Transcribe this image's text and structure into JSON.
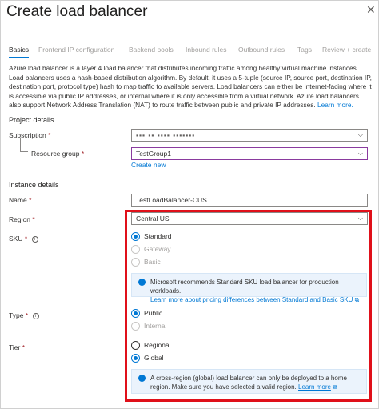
{
  "window": {
    "title": "Create load balancer"
  },
  "tabs": [
    {
      "label": "Basics"
    },
    {
      "label": "Frontend IP configuration"
    },
    {
      "label": "Backend pools"
    },
    {
      "label": "Inbound rules"
    },
    {
      "label": "Outbound rules"
    },
    {
      "label": "Tags"
    },
    {
      "label": "Review + create"
    }
  ],
  "intro": {
    "text": "Azure load balancer is a layer 4 load balancer that distributes incoming traffic among healthy virtual machine instances. Load balancers uses a hash-based distribution algorithm. By default, it uses a 5-tuple (source IP, source port, destination IP, destination port, protocol type) hash to map traffic to available servers. Load balancers can either be internet-facing where it is accessible via public IP addresses, or internal where it is only accessible from a virtual network. Azure load balancers also support Network Address Translation (NAT) to route traffic between public and private IP addresses.",
    "link": "Learn more."
  },
  "project": {
    "heading": "Project details",
    "subscription_label": "Subscription",
    "subscription_value": "▪▪▪ ▪▪ ▪▪▪▪ ▪▪▪▪▪▪▪",
    "resource_group_label": "Resource group",
    "resource_group_value": "TestGroup1",
    "create_new": "Create new"
  },
  "instance": {
    "heading": "Instance details",
    "name_label": "Name",
    "name_value": "TestLoadBalancer-CUS",
    "region_label": "Region",
    "region_value": "Central US",
    "sku_label": "SKU",
    "sku_options": [
      {
        "label": "Standard",
        "selected": true,
        "enabled": true
      },
      {
        "label": "Gateway",
        "selected": false,
        "enabled": false
      },
      {
        "label": "Basic",
        "selected": false,
        "enabled": false
      }
    ],
    "sku_info": "Microsoft recommends Standard SKU load balancer for production workloads.",
    "sku_info_link": "Learn more about pricing differences between Standard and Basic SKU",
    "type_label": "Type",
    "type_options": [
      {
        "label": "Public",
        "selected": true,
        "enabled": true
      },
      {
        "label": "Internal",
        "selected": false,
        "enabled": false
      }
    ],
    "tier_label": "Tier",
    "tier_options": [
      {
        "label": "Regional",
        "selected": false,
        "enabled": true
      },
      {
        "label": "Global",
        "selected": true,
        "enabled": true
      }
    ],
    "tier_info": "A cross-region (global) load balancer can only be deployed to a home region. Make sure you have selected a valid region.",
    "tier_info_link": "Learn more"
  },
  "required_marker": "*",
  "colors": {
    "accent": "#0078d4",
    "highlight": "#e0101a",
    "required": "#a4262c"
  }
}
